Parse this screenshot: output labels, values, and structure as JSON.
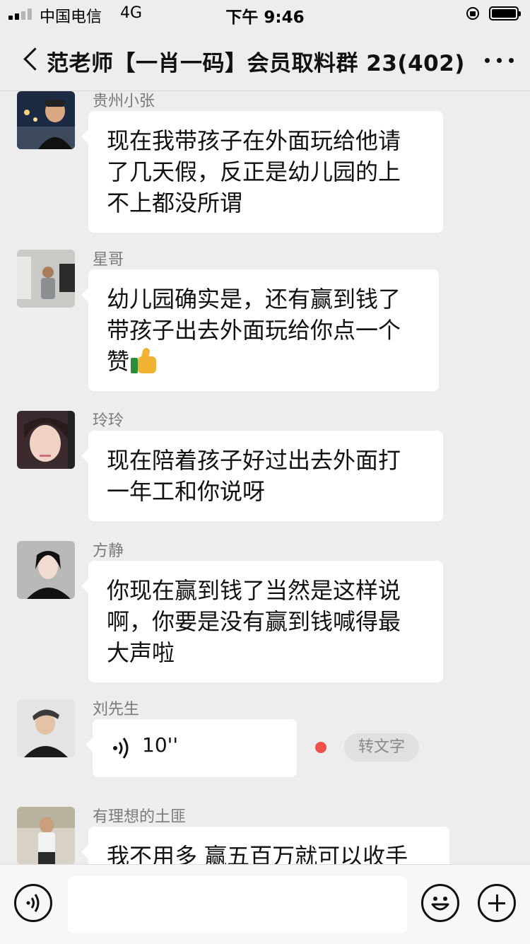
{
  "status_bar": {
    "carrier": "中国电信",
    "network": "4G",
    "time": "下午 9:46",
    "icons": [
      "signal-icon",
      "orientation-lock-icon",
      "battery-icon"
    ]
  },
  "nav": {
    "title": "范老师【一肖一码】会员取料群 23(402)",
    "back_icon": "chevron-left-icon",
    "more_icon": "more-dots-icon"
  },
  "messages": [
    {
      "sender": "贵州小张",
      "text": "现在我带孩子在外面玩给他请\n了几天假，反正是幼儿园的上\n不上都没所谓"
    },
    {
      "sender": "星哥",
      "text": "幼儿园确实是，还有赢到钱了\n带孩子出去外面玩给你点一个\n赞",
      "emoji": "thumbs-up-icon"
    },
    {
      "sender": "玲玲",
      "text": "现在陪着孩子好过出去外面打\n一年工和你说呀"
    },
    {
      "sender": "方静",
      "text": "你现在赢到钱了当然是这样说\n啊，你要是没有赢到钱喊得最\n大声啦"
    },
    {
      "sender": "刘先生",
      "voice_duration": "10''",
      "transcribe_label": "转文字"
    },
    {
      "sender": "有理想的土匪",
      "text": "我不用多 赢五百万就可以收手"
    }
  ],
  "input_bar": {
    "placeholder": "",
    "icons": [
      "voice-toggle-icon",
      "emoji-icon",
      "plus-icon"
    ]
  },
  "colors": {
    "background": "#ededed",
    "bubble": "#ffffff",
    "unread_dot": "#f0504a"
  }
}
